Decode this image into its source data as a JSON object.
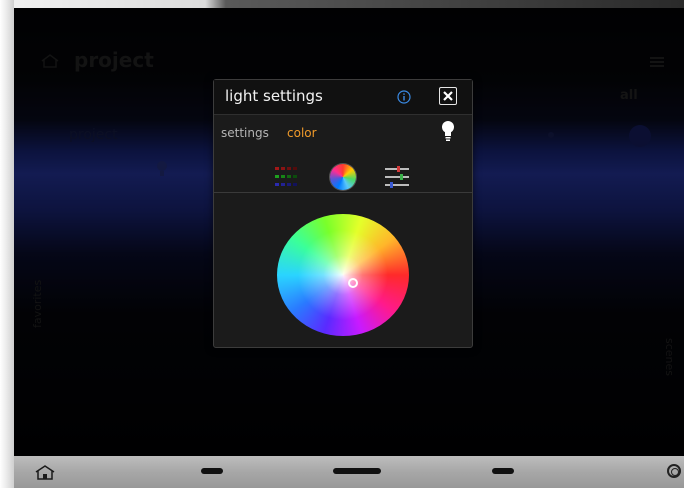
{
  "background": {
    "title": "project",
    "all_label": "all",
    "section_label": "project",
    "left_side_label": "favorites",
    "right_side_label": "scenes"
  },
  "dialog": {
    "title": "light settings",
    "tabs": [
      {
        "label": "settings",
        "active": false
      },
      {
        "label": "color",
        "active": true
      }
    ],
    "mode_icons": [
      "swatch-grid-icon",
      "color-wheel-icon",
      "sliders-icon"
    ],
    "accent_color": "#f09a2a"
  },
  "navbar": {
    "icons": [
      "home-icon",
      "power-icon"
    ]
  }
}
